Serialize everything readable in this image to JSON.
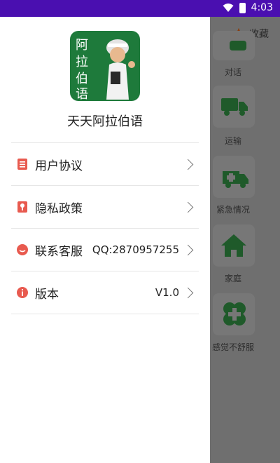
{
  "status": {
    "time": "4:03",
    "icons": [
      "wifi-icon",
      "battery-icon"
    ]
  },
  "drawer": {
    "app_title": "天天阿拉伯语",
    "logo_text": [
      "阿",
      "拉",
      "伯",
      "语"
    ],
    "items": [
      {
        "label": "用户协议",
        "value": "",
        "icon": "document-icon"
      },
      {
        "label": "隐私政策",
        "value": "",
        "icon": "privacy-icon"
      },
      {
        "label": "联系客服",
        "value": "QQ:2870957255",
        "icon": "chat-icon"
      },
      {
        "label": "版本",
        "value": "V1.0",
        "icon": "info-icon"
      }
    ]
  },
  "background": {
    "favorite_label": "收藏",
    "categories": [
      {
        "label": "对话",
        "icon": "chat-bubble-icon"
      },
      {
        "label": "运输",
        "icon": "truck-icon"
      },
      {
        "label": "紧急情况",
        "icon": "ambulance-icon"
      },
      {
        "label": "家庭",
        "icon": "home-icon"
      },
      {
        "label": "感觉不舒服",
        "icon": "medical-cross-icon"
      }
    ]
  },
  "colors": {
    "accent_red": "#e85a4f",
    "brand_green": "#1e7a3b",
    "status_bar": "#4a0fb0"
  }
}
